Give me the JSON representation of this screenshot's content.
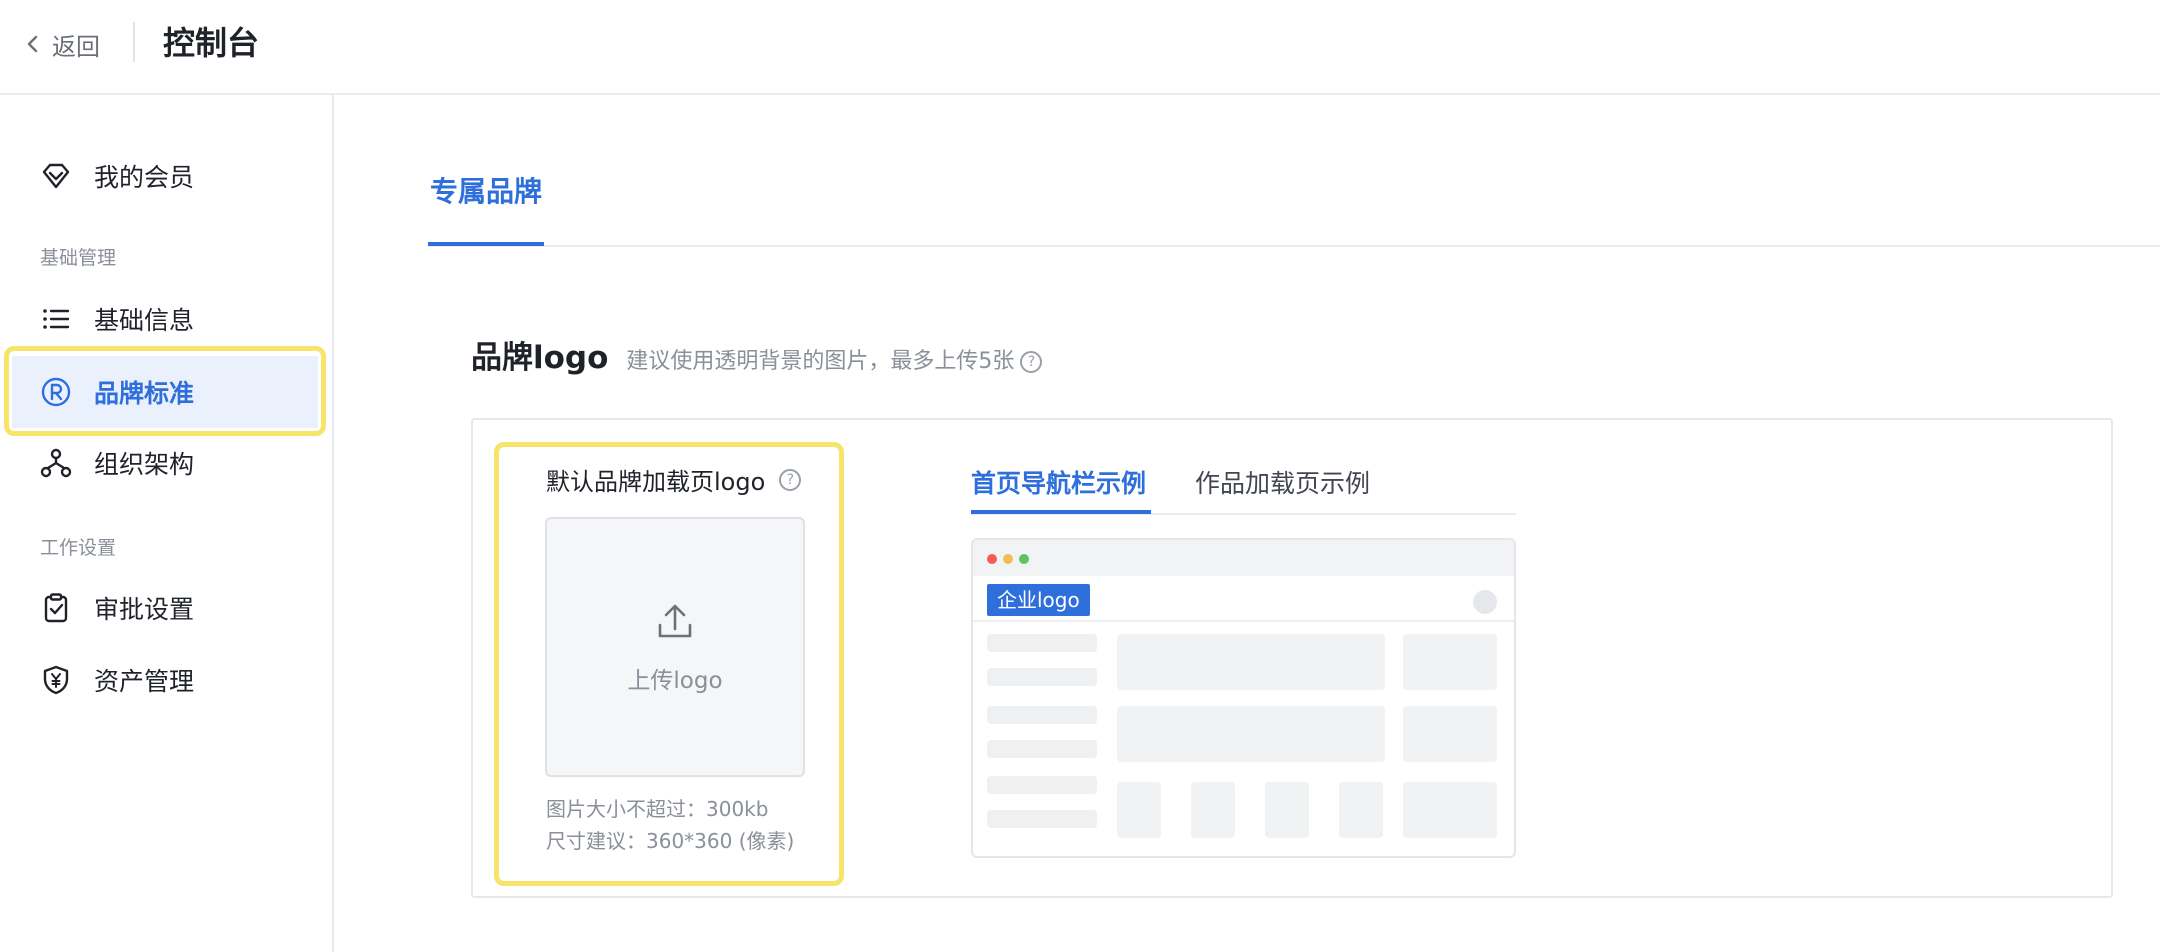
{
  "header": {
    "back_label": "返回",
    "title": "控制台"
  },
  "sidebar": {
    "top_item": {
      "label": "我的会员",
      "icon": "diamond-icon"
    },
    "groups": [
      {
        "label": "基础管理",
        "items": [
          {
            "label": "基础信息",
            "icon": "list-icon"
          },
          {
            "label": "品牌标准",
            "icon": "registered-icon",
            "active": true
          },
          {
            "label": "组织架构",
            "icon": "org-chart-icon"
          }
        ]
      },
      {
        "label": "工作设置",
        "items": [
          {
            "label": "审批设置",
            "icon": "clipboard-check-icon"
          },
          {
            "label": "资产管理",
            "icon": "yen-shield-icon"
          }
        ]
      }
    ]
  },
  "main": {
    "tab": "专属品牌",
    "section_title": "品牌logo",
    "section_desc": "建议使用透明背景的图片，最多上传5张",
    "upload": {
      "label": "默认品牌加载页logo",
      "button_text": "上传logo",
      "note_size": "图片大小不超过：300kb",
      "note_dim": "尺寸建议：360*360 (像素)"
    },
    "preview_tabs": [
      {
        "label": "首页导航栏示例",
        "active": true
      },
      {
        "label": "作品加载页示例",
        "active": false
      }
    ],
    "preview": {
      "logo_chip": "企业logo"
    }
  },
  "colors": {
    "accent": "#2e6fdb",
    "highlight": "#f6e56a",
    "active_bg": "#eaf1fd"
  }
}
